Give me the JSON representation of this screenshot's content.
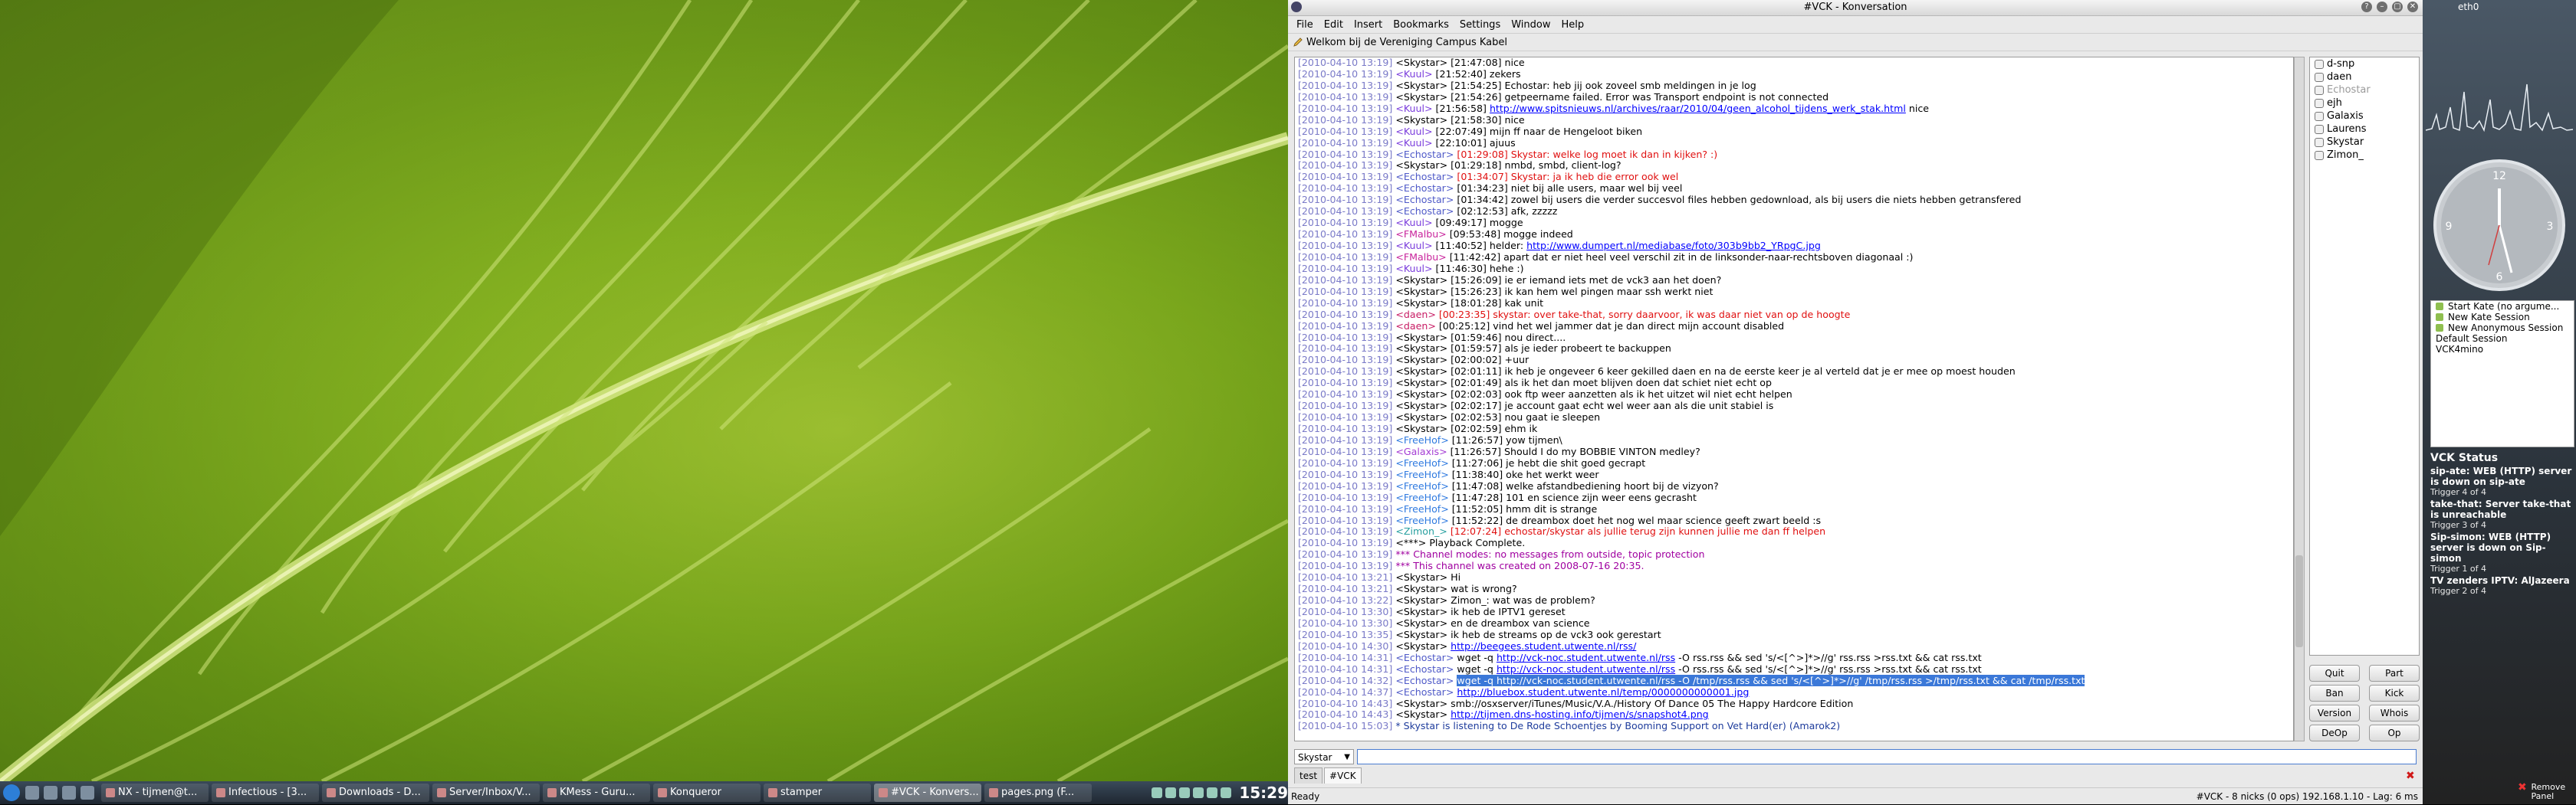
{
  "window": {
    "title": "#VCK - Konversation"
  },
  "menu": [
    "File",
    "Edit",
    "Insert",
    "Bookmarks",
    "Settings",
    "Window",
    "Help"
  ],
  "topic": "Welkom bij de Vereniging Campus Kabel",
  "chat": [
    {
      "t": "[2010-04-10 13:19]",
      "n": "<Skystar>",
      "c": "nk-skystar",
      "m": " [21:47:08] nice"
    },
    {
      "t": "[2010-04-10 13:19]",
      "n": "<Kuul>",
      "c": "nk-kuul",
      "m": " [21:52:40] zekers"
    },
    {
      "t": "[2010-04-10 13:19]",
      "n": "<Skystar>",
      "c": "nk-skystar",
      "m": " [21:54:25] Echostar: heb jij ook zoveel smb meldingen in je log"
    },
    {
      "t": "[2010-04-10 13:19]",
      "n": "<Skystar>",
      "c": "nk-skystar",
      "m": " [21:54:26] getpeername failed. Error was Transport endpoint is not connected"
    },
    {
      "t": "[2010-04-10 13:19]",
      "n": "<Kuul>",
      "c": "nk-kuul",
      "m": " [21:56:58] ",
      "link": "http://www.spitsnieuws.nl/archives/raar/2010/04/geen_alcohol_tijdens_werk_stak.html",
      "after": " nice"
    },
    {
      "t": "[2010-04-10 13:19]",
      "n": "<Skystar>",
      "c": "nk-skystar",
      "m": " [21:58:30] nice"
    },
    {
      "t": "[2010-04-10 13:19]",
      "n": "<Kuul>",
      "c": "nk-kuul",
      "m": " [22:07:49] mijn ff naar de Hengeloot biken"
    },
    {
      "t": "[2010-04-10 13:19]",
      "n": "<Kuul>",
      "c": "nk-kuul",
      "m": " [22:10:01] ajuus"
    },
    {
      "t": "[2010-04-10 13:19]",
      "n": "<Echostar>",
      "c": "nk-echostar",
      "m": " [01:29:08] Skystar: welke log moet ik dan in kijken? :)",
      "red": true
    },
    {
      "t": "[2010-04-10 13:19]",
      "n": "<Skystar>",
      "c": "nk-skystar",
      "m": " [01:29:18] nmbd, smbd, client-log?"
    },
    {
      "t": "[2010-04-10 13:19]",
      "n": "<Echostar>",
      "c": "nk-echostar",
      "m": " [01:34:07] Skystar: ja ik heb die error ook wel",
      "red": true
    },
    {
      "t": "[2010-04-10 13:19]",
      "n": "<Echostar>",
      "c": "nk-echostar",
      "m": " [01:34:23] niet bij alle users, maar wel bij veel"
    },
    {
      "t": "[2010-04-10 13:19]",
      "n": "<Echostar>",
      "c": "nk-echostar",
      "m": " [01:34:42] zowel bij users die verder succesvol files hebben gedownload, als bij users die niets hebben getransfered"
    },
    {
      "t": "[2010-04-10 13:19]",
      "n": "<Echostar>",
      "c": "nk-echostar",
      "m": " [02:12:53] afk, zzzzz"
    },
    {
      "t": "[2010-04-10 13:19]",
      "n": "<Kuul>",
      "c": "nk-kuul",
      "m": " [09:49:17] mogge"
    },
    {
      "t": "[2010-04-10 13:19]",
      "n": "<FMalbu>",
      "c": "nk-fmalbu",
      "m": " [09:53:48] mogge indeed"
    },
    {
      "t": "[2010-04-10 13:19]",
      "n": "<Kuul>",
      "c": "nk-kuul",
      "m": " [11:40:52] helder: ",
      "link": "http://www.dumpert.nl/mediabase/foto/303b9bb2_YRpgC.jpg",
      "after": ""
    },
    {
      "t": "[2010-04-10 13:19]",
      "n": "<FMalbu>",
      "c": "nk-fmalbu",
      "m": " [11:42:42] apart dat er niet heel veel verschil zit in de linksonder-naar-rechtsboven diagonaal :)"
    },
    {
      "t": "[2010-04-10 13:19]",
      "n": "<Kuul>",
      "c": "nk-kuul",
      "m": " [11:46:30] hehe :)"
    },
    {
      "t": "[2010-04-10 13:19]",
      "n": "<Skystar>",
      "c": "nk-skystar",
      "m": " [15:26:09] ie er iemand iets met de vck3 aan het doen?"
    },
    {
      "t": "[2010-04-10 13:19]",
      "n": "<Skystar>",
      "c": "nk-skystar",
      "m": " [15:26:23] ik kan hem wel pingen maar ssh werkt niet"
    },
    {
      "t": "[2010-04-10 13:19]",
      "n": "<Skystar>",
      "c": "nk-skystar",
      "m": " [18:01:28] kak unit"
    },
    {
      "t": "[2010-04-10 13:19]",
      "n": "<daen>",
      "c": "nk-daen",
      "m": " [00:23:35] skystar: over take-that, sorry daarvoor, ik was daar niet van op de hoogte",
      "red": true
    },
    {
      "t": "[2010-04-10 13:19]",
      "n": "<daen>",
      "c": "nk-daen",
      "m": " [00:25:12] vind het wel jammer dat je dan direct mijn account disabled"
    },
    {
      "t": "[2010-04-10 13:19]",
      "n": "<Skystar>",
      "c": "nk-skystar",
      "m": " [01:59:46] nou direct...."
    },
    {
      "t": "[2010-04-10 13:19]",
      "n": "<Skystar>",
      "c": "nk-skystar",
      "m": " [01:59:57] als je ieder probeert te backuppen"
    },
    {
      "t": "[2010-04-10 13:19]",
      "n": "<Skystar>",
      "c": "nk-skystar",
      "m": " [02:00:02] +uur"
    },
    {
      "t": "[2010-04-10 13:19]",
      "n": "<Skystar>",
      "c": "nk-skystar",
      "m": " [02:01:11] ik heb je ongeveer 6 keer gekilled daen en na de eerste keer je al verteld dat je er mee op moest houden"
    },
    {
      "t": "[2010-04-10 13:19]",
      "n": "<Skystar>",
      "c": "nk-skystar",
      "m": " [02:01:49] als ik het dan moet blijven doen dat schiet niet echt op"
    },
    {
      "t": "[2010-04-10 13:19]",
      "n": "<Skystar>",
      "c": "nk-skystar",
      "m": " [02:02:03] ook ftp weer aanzetten als ik het uitzet wil niet echt helpen"
    },
    {
      "t": "[2010-04-10 13:19]",
      "n": "<Skystar>",
      "c": "nk-skystar",
      "m": " [02:02:17] je account gaat echt wel weer aan als die unit stabiel is"
    },
    {
      "t": "[2010-04-10 13:19]",
      "n": "<Skystar>",
      "c": "nk-skystar",
      "m": " [02:02:53] nou gaat ie sleepen"
    },
    {
      "t": "[2010-04-10 13:19]",
      "n": "<Skystar>",
      "c": "nk-skystar",
      "m": " [02:02:59] ehm ik"
    },
    {
      "t": "[2010-04-10 13:19]",
      "n": "<FreeHof>",
      "c": "nk-freehof",
      "m": " [11:26:57] yow tijmen\\"
    },
    {
      "t": "[2010-04-10 13:19]",
      "n": "<Galaxis>",
      "c": "nk-galaxis",
      "m": " [11:26:57] Should I do my BOBBIE VINTON medley?"
    },
    {
      "t": "[2010-04-10 13:19]",
      "n": "<FreeHof>",
      "c": "nk-freehof",
      "m": " [11:27:06] je hebt die shit goed gecrapt"
    },
    {
      "t": "[2010-04-10 13:19]",
      "n": "<FreeHof>",
      "c": "nk-freehof",
      "m": " [11:38:40] oke het werkt weer"
    },
    {
      "t": "[2010-04-10 13:19]",
      "n": "<FreeHof>",
      "c": "nk-freehof",
      "m": " [11:47:08] welke afstandbediening hoort bij de vizyon?"
    },
    {
      "t": "[2010-04-10 13:19]",
      "n": "<FreeHof>",
      "c": "nk-freehof",
      "m": " [11:47:28] 101 en science zijn weer eens gecrasht"
    },
    {
      "t": "[2010-04-10 13:19]",
      "n": "<FreeHof>",
      "c": "nk-freehof",
      "m": " [11:52:05] hmm dit is strange"
    },
    {
      "t": "[2010-04-10 13:19]",
      "n": "<FreeHof>",
      "c": "nk-freehof",
      "m": " [11:52:22] de dreambox doet het nog wel maar science geeft zwart beeld :s"
    },
    {
      "t": "[2010-04-10 13:19]",
      "n": "<Zimon_>",
      "c": "nk-zimon",
      "m": " [12:07:24] echostar/skystar als jullie terug zijn kunnen jullie me dan ff helpen",
      "red": true
    },
    {
      "t": "[2010-04-10 13:19]",
      "n": "<***>",
      "c": "nk-skystar",
      "m": " Playback Complete."
    },
    {
      "t": "[2010-04-10 13:19]",
      "n": "***",
      "c": "purple",
      "m": " Channel modes: no messages from outside, topic protection",
      "purple": true
    },
    {
      "t": "[2010-04-10 13:19]",
      "n": "***",
      "c": "purple",
      "m": " This channel was created on 2008-07-16 20:35.",
      "purple": true
    },
    {
      "t": "[2010-04-10 13:21]",
      "n": "<Skystar>",
      "c": "nk-skystar",
      "m": " Hi"
    },
    {
      "t": "[2010-04-10 13:21]",
      "n": "<Skystar>",
      "c": "nk-skystar",
      "m": " wat is wrong?"
    },
    {
      "t": "[2010-04-10 13:22]",
      "n": "<Skystar>",
      "c": "nk-skystar",
      "m": " Zimon_: wat was de problem?"
    },
    {
      "t": "[2010-04-10 13:30]",
      "n": "<Skystar>",
      "c": "nk-skystar",
      "m": " ik heb de IPTV1 gereset"
    },
    {
      "t": "[2010-04-10 13:30]",
      "n": "<Skystar>",
      "c": "nk-skystar",
      "m": " en de dreambox van science"
    },
    {
      "t": "[2010-04-10 13:35]",
      "n": "<Skystar>",
      "c": "nk-skystar",
      "m": " ik heb de streams op de vck3 ook gerestart"
    },
    {
      "t": "[2010-04-10 14:30]",
      "n": "<Skystar>",
      "c": "nk-skystar",
      "m": " ",
      "link": "http://beegees.student.utwente.nl/rss/",
      "after": ""
    },
    {
      "t": "[2010-04-10 14:31]",
      "n": "<Echostar>",
      "c": "nk-echostar",
      "m": " wget -q ",
      "link": "http://vck-noc.student.utwente.nl/rss",
      "after": " -O rss.rss && sed 's/<[^>]*>//g' rss.rss >rss.txt && cat rss.txt"
    },
    {
      "t": "[2010-04-10 14:31]",
      "n": "<Echostar>",
      "c": "nk-echostar",
      "m": " wget -q ",
      "link": "http://vck-noc.student.utwente.nl/rss",
      "after": " -O rss.rss && sed 's/<[^>]*>//g' rss.rss >rss.txt && cat rss.txt"
    },
    {
      "t": "[2010-04-10 14:32]",
      "n": "<Echostar>",
      "c": "nk-echostar",
      "m": " ",
      "selected": "wget -q http://vck-noc.student.utwente.nl/rss -O /tmp/rss.rss && sed 's/<[^>]*>//g' /tmp/rss.rss >/tmp/rss.txt && cat /tmp/rss.txt"
    },
    {
      "t": "[2010-04-10 14:37]",
      "n": "<Echostar>",
      "c": "nk-echostar",
      "m": " ",
      "link": "http://bluebox.student.utwente.nl/temp/0000000000001.jpg",
      "after": ""
    },
    {
      "t": "[2010-04-10 14:43]",
      "n": "<Skystar>",
      "c": "nk-skystar",
      "m": " smb://osxserver/iTunes/Music/V.A./History Of Dance 05 The Happy Hardcore Edition"
    },
    {
      "t": "[2010-04-10 14:43]",
      "n": "<Skystar>",
      "c": "nk-skystar",
      "m": " ",
      "link": "http://tijmen.dns-hosting.info/tijmen/s/snapshot4.png",
      "after": ""
    },
    {
      "t": "[2010-04-10 15:03]",
      "n": "*",
      "c": "action",
      "m": " Skystar is listening to De Rode Schoentjes by Booming Support on Vet Hard(er) (Amarok2)",
      "action": true
    }
  ],
  "nicks": [
    {
      "name": "d-snp",
      "away": false
    },
    {
      "name": "daen",
      "away": false
    },
    {
      "name": "Echostar",
      "away": true
    },
    {
      "name": "ejh",
      "away": false
    },
    {
      "name": "Galaxis",
      "away": false
    },
    {
      "name": "Laurens",
      "away": false
    },
    {
      "name": "Skystar",
      "away": false
    },
    {
      "name": "Zimon_",
      "away": false
    }
  ],
  "buttons": {
    "quit": "Quit",
    "part": "Part",
    "ban": "Ban",
    "kick": "Kick",
    "version": "Version",
    "whois": "Whois",
    "deop": "DeOp",
    "op": "Op"
  },
  "input": {
    "nick": "Skystar",
    "value": ""
  },
  "tabs": [
    "test",
    "#VCK"
  ],
  "status": {
    "left": "Ready",
    "right": "#VCK - 8 nicks (0 ops)  192.168.1.10 - Lag: 6 ms"
  },
  "panel": {
    "net_label": "eth0",
    "kate_items": [
      "Start Kate (no argume...",
      "New Kate Session",
      "New Anonymous Session",
      "Default Session",
      "VCK4mino"
    ],
    "vck_title": "VCK Status",
    "vck_entries": [
      {
        "msg": "sip-ate: WEB (HTTP) server is down on sip-ate",
        "trig": "Trigger 4 of 4"
      },
      {
        "msg": "take-that: Server take-that is unreachable",
        "trig": "Trigger 3 of 4"
      },
      {
        "msg": "Sip-simon: WEB (HTTP) server is down on Sip-simon",
        "trig": "Trigger 1 of 4"
      },
      {
        "msg": "TV zenders IPTV: AlJazeera",
        "trig": "Trigger 2 of 4"
      }
    ],
    "remove_label": "Remove Panel",
    "clock_numbers": {
      "twelve": "12",
      "three": "3",
      "six": "6",
      "nine": "9"
    }
  },
  "taskbar": {
    "tasks": [
      "NX - tijmen@t...",
      "Infectious - [3...",
      "Downloads - D...",
      "Server/Inbox/V...",
      "KMess - Guru...",
      "Konqueror",
      "stamper",
      "#VCK - Konvers...",
      "pages.png (F..."
    ],
    "clock": "15:29"
  }
}
